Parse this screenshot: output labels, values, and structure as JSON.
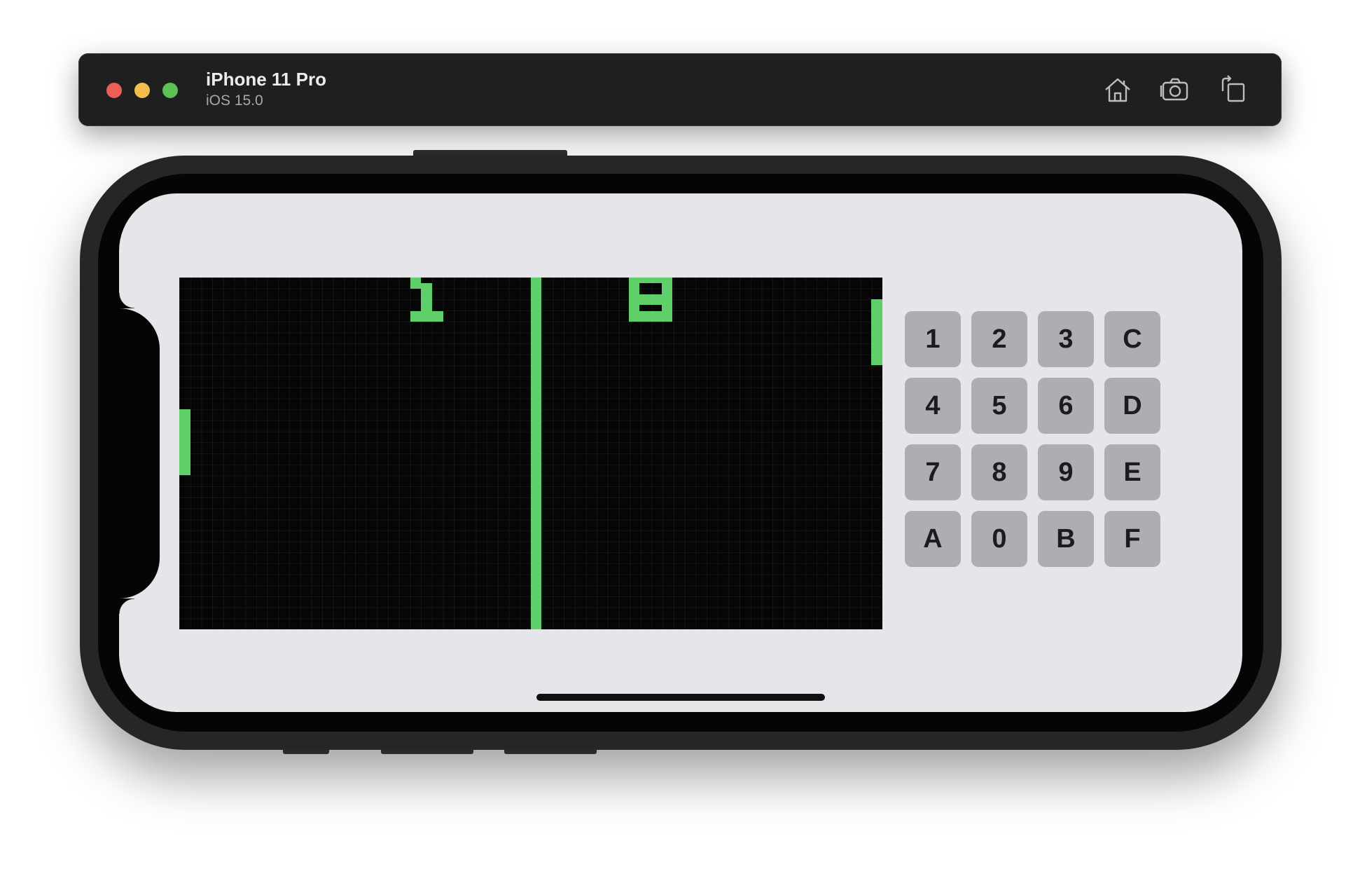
{
  "simulator": {
    "device_name": "iPhone 11 Pro",
    "os_version": "iOS 15.0",
    "toolbar_icons": [
      "home-icon",
      "screenshot-camera-icon",
      "rotate-icon"
    ]
  },
  "game": {
    "score_left": "1",
    "score_right": "8",
    "pixel_color": "#5fcf6a"
  },
  "keypad": {
    "keys": [
      "1",
      "2",
      "3",
      "C",
      "4",
      "5",
      "6",
      "D",
      "7",
      "8",
      "9",
      "E",
      "A",
      "0",
      "B",
      "F"
    ]
  }
}
